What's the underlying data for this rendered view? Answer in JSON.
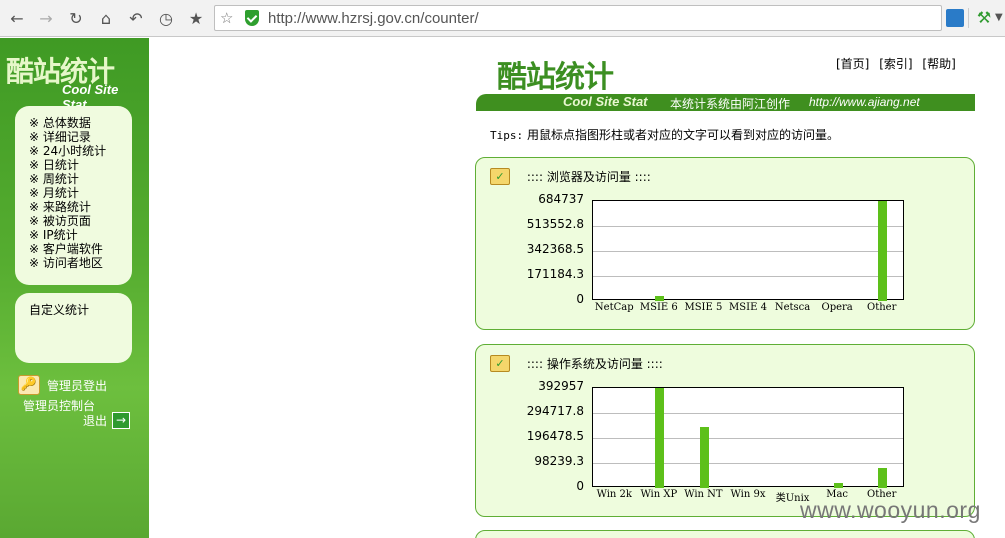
{
  "browser": {
    "url": "http://www.hzrsj.gov.cn/counter/"
  },
  "sidebar": {
    "logo_cn": "酷站统计",
    "logo_en": "Cool Site Stat",
    "menu": [
      "※ 总体数据",
      "※ 详细记录",
      "※ 24小时统计",
      "※ 日统计",
      "※ 周统计",
      "※ 月统计",
      "※ 来路统计",
      "※ 被访页面",
      "※ IP统计",
      "※ 客户端软件",
      "※ 访问者地区"
    ],
    "custom_stats": "自定义统计",
    "admin_logout": "管理员登出",
    "admin_panel": "管理员控制台",
    "exit": "退出"
  },
  "header": {
    "logo_cn": "酷站统计",
    "logo_en": "Cool Site Stat",
    "author": "本统计系统由阿江创作",
    "site": "http://www.ajiang.net",
    "links": [
      "[首页]",
      "[索引]",
      "[帮助]"
    ]
  },
  "tips": {
    "label": "Tips:",
    "text": "用鼠标点指图形柱或者对应的文字可以看到对应的访问量。"
  },
  "chart_data": [
    {
      "type": "bar",
      "title": ":::: 浏览器及访问量 ::::",
      "categories": [
        "NetCap",
        "MSIE 6",
        "MSIE 5",
        "MSIE 4",
        "Netsca",
        "Opera",
        "Other"
      ],
      "values": [
        0,
        36000,
        0,
        0,
        0,
        0,
        684737
      ],
      "yticks": [
        "684737",
        "513552.8",
        "342368.5",
        "171184.3",
        "0"
      ],
      "ylim": [
        0,
        684737
      ]
    },
    {
      "type": "bar",
      "title": ":::: 操作系统及访问量 ::::",
      "categories": [
        "Win 2k",
        "Win XP",
        "Win NT",
        "Win 9x",
        "类Unix",
        "Mac",
        "Other"
      ],
      "values": [
        0,
        392957,
        240000,
        0,
        0,
        20000,
        80000
      ],
      "yticks": [
        "392957",
        "294717.8",
        "196478.5",
        "98239.3",
        "0"
      ],
      "ylim": [
        0,
        392957
      ]
    }
  ],
  "watermark": "www.wooyun.org"
}
